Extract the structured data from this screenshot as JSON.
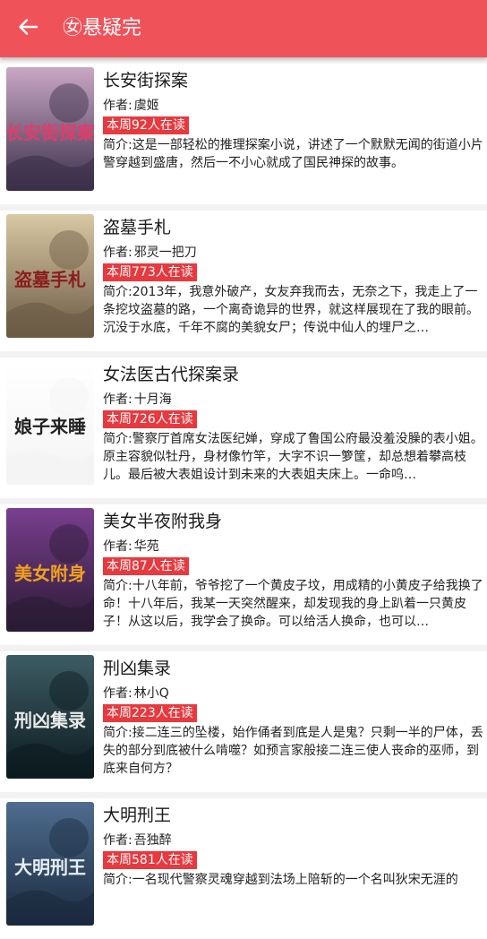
{
  "header": {
    "title": "㊛悬疑完",
    "back_icon": "arrow-left-icon",
    "color": "#f0525a"
  },
  "labels": {
    "author_prefix": "作者:",
    "intro_prefix": "简介:"
  },
  "badge_color": "#e8393f",
  "books": [
    {
      "title": "长安街探案",
      "author": "虞姬",
      "readers": "本周92人在读",
      "intro": "这是一部轻松的推理探案小说，讲述了一个默默无闻的街道小片警穿越到盛唐，然后一不小心就成了国民神探的故事。",
      "cover_text": "长安街探案"
    },
    {
      "title": "盗墓手札",
      "author": "邪灵一把刀",
      "readers": "本周773人在读",
      "intro": "2013年，我意外破产，女友弃我而去，无奈之下，我走上了一条挖坟盗墓的路，一个离奇诡异的世界，就这样展现在了我的眼前。沉没于水底，千年不腐的美貌女尸；传说中仙人的埋尸之…",
      "cover_text": "盗墓手札"
    },
    {
      "title": "女法医古代探案录",
      "author": "十月海",
      "readers": "本周726人在读",
      "intro": "警察厅首席女法医纪婵，穿成了鲁国公府最没羞没臊的表小姐。原主容貌似牡丹，身材像竹竿，大字不识一箩筐，却总想着攀高枝儿。最后被大表姐设计到未来的大表姐夫床上。一命呜…",
      "cover_text": "娘子来睡"
    },
    {
      "title": "美女半夜附我身",
      "author": "华苑",
      "readers": "本周87人在读",
      "intro": "十八年前，爷爷挖了一个黄皮子坟，用成精的小黄皮子给我换了命！十八年后，我某一天突然醒来，却发现我的身上趴着一只黄皮子！从这以后，我学会了换命。可以给活人换命，也可以…",
      "cover_text": "美女附身"
    },
    {
      "title": "刑凶集录",
      "author": "林小Q",
      "readers": "本周223人在读",
      "intro": "接二连三的坠楼，始作俑者到底是人是鬼？只剩一半的尸体，丢失的部分到底被什么啃噬？如预言家般接二连三使人丧命的巫师，到底来自何方？",
      "cover_text": "刑凶集录"
    },
    {
      "title": "大明刑王",
      "author": "吾独醉",
      "readers": "本周581人在读",
      "intro": "一名现代警察灵魂穿越到法场上陪斩的一个名叫狄宋无涯的",
      "cover_text": "大明刑王"
    }
  ]
}
